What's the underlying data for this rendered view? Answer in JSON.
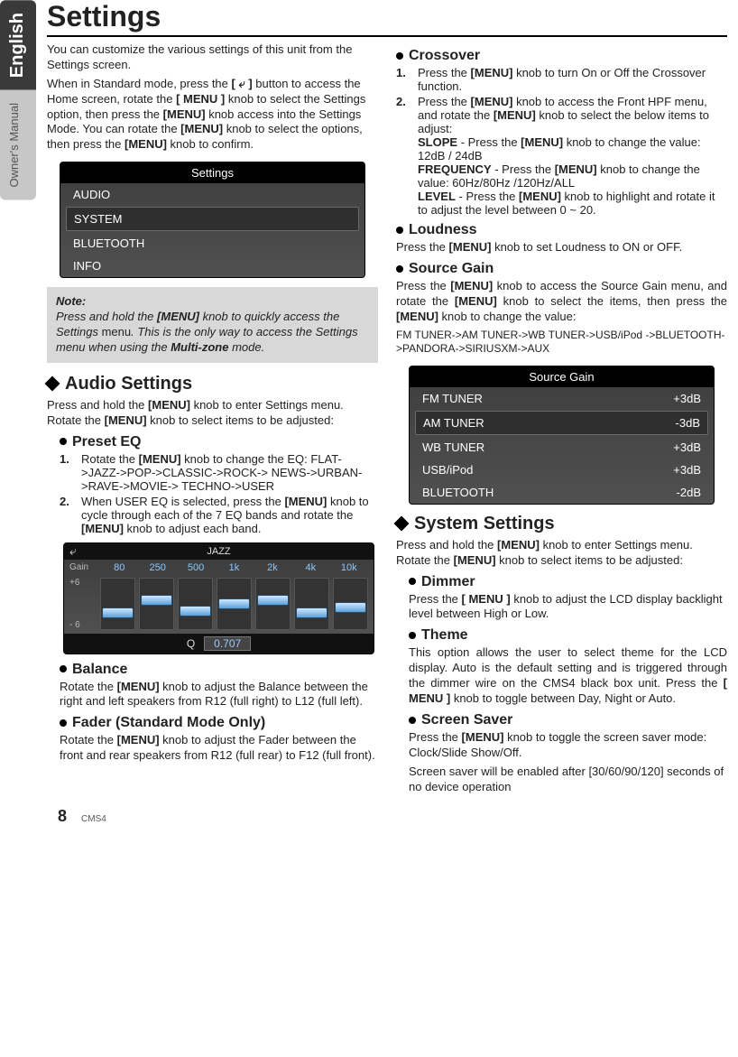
{
  "sideTabs": {
    "dark": "English",
    "light": "Owner's Manual"
  },
  "title": "Settings",
  "intro": {
    "p1a": "You can customize the various settings of this unit from the Settings screen.",
    "p2a": "When in Standard mode, press the ",
    "p2b": "[  ⤶  ]",
    "p2c": " button to access the Home screen, rotate the ",
    "p2d": "[ MENU ]",
    "p2e": " knob to select the Settings  option, then press the ",
    "p2f": "[MENU]",
    "p2g": " knob access into the Settings Mode. You can rotate the ",
    "p2h": "[MENU]",
    "p2i": " knob to select the options, then press the ",
    "p2j": "[MENU]",
    "p2k": " knob to confirm."
  },
  "settingsPanel": {
    "title": "Settings",
    "items": [
      "AUDIO",
      "SYSTEM",
      "BLUETOOTH",
      "INFO"
    ],
    "selectedIndex": 1
  },
  "note": {
    "label": "Note:",
    "a": "Press and hold the ",
    "b": "[MENU]",
    "c": " knob to quickly access the Settings ",
    "d": "menu",
    "e": ". This is the only way to access the Settings menu when using the ",
    "f": "Multi-zone",
    "g": " mode."
  },
  "audio": {
    "heading": "Audio Settings",
    "intro_a": "Press and hold the ",
    "intro_b": "[MENU]",
    "intro_c": " knob to enter Settings menu. Rotate the ",
    "intro_d": "[MENU]",
    "intro_e": " knob to select items to be adjusted:",
    "preset": {
      "heading": "Preset EQ",
      "s1a": "Rotate the ",
      "s1b": "[MENU]",
      "s1c": " knob to change the EQ: FLAT->JAZZ->POP->CLASSIC->ROCK-> NEWS->URBAN->RAVE->MOVIE-> TECHNO->USER",
      "s2a": "When USER EQ is selected, press the ",
      "s2b": "[MENU]",
      "s2c": " knob to cycle through each of the 7 EQ bands and rotate the ",
      "s2d": "[MENU]",
      "s2e": " knob to adjust each band."
    },
    "eq": {
      "title": "JAZZ",
      "gainLabel": "Gain",
      "freqs": [
        "80",
        "250",
        "500",
        "1k",
        "2k",
        "4k",
        "10k"
      ],
      "scaleTop": "+6",
      "scaleBot": "- 6",
      "thumbPos": [
        32,
        18,
        30,
        22,
        18,
        32,
        26
      ],
      "qLabel": "Q",
      "qValue": "0.707"
    },
    "balance": {
      "heading": "Balance",
      "a": "Rotate the ",
      "b": "[MENU]",
      "c": " knob to adjust the Balance between the right and left speakers from R12 (full right) to L12 (full left)."
    },
    "fader": {
      "heading": "Fader (Standard Mode Only)",
      "a": "Rotate the ",
      "b": "[MENU]",
      "c": " knob to adjust the Fader between the front and rear speakers from R12 (full rear) to F12 (full front)."
    }
  },
  "crossover": {
    "heading": "Crossover",
    "s1a": "Press the ",
    "s1b": "[MENU]",
    "s1c": " knob to turn On or Off the Crossover function.",
    "s2a": "Press the ",
    "s2b": "[MENU]",
    "s2c": " knob to access the Front HPF menu, and rotate the ",
    "s2d": "[MENU]",
    "s2e": " knob to select the below items to adjust:",
    "slope_l": "SLOPE",
    "slope_a": " - Press the ",
    "slope_b": "[MENU]",
    "slope_c": " knob to change the value: 12dB / 24dB",
    "freq_l": "FREQUENCY",
    "freq_a": " - Press the ",
    "freq_b": "[MENU]",
    "freq_c": " knob to change the value: 60Hz/80Hz /120Hz/ALL",
    "level_l": "LEVEL",
    "level_a": " - Press the ",
    "level_b": "[MENU]",
    "level_c": " knob to highlight and rotate it to adjust the level between 0 ~ 20."
  },
  "loudness": {
    "heading": "Loudness",
    "a": "Press the ",
    "b": "[MENU]",
    "c": " knob to set Loudness to ON or OFF."
  },
  "sourceGain": {
    "heading": "Source Gain",
    "a": "Press the ",
    "b": "[MENU]",
    "c": " knob to access the Source Gain menu, and rotate the ",
    "d": "[MENU]",
    "e": " knob to select the items, then press the ",
    "f": "[MENU]",
    "g": " knob to change the value:",
    "chain": "FM TUNER->AM TUNER->WB TUNER->USB/iPod ->BLUETOOTH->PANDORA->SIRIUSXM->AUX",
    "panel": {
      "title": "Source Gain",
      "rows": [
        {
          "name": "FM TUNER",
          "val": "+3dB"
        },
        {
          "name": "AM TUNER",
          "val": "-3dB"
        },
        {
          "name": "WB TUNER",
          "val": "+3dB"
        },
        {
          "name": "USB/iPod",
          "val": "+3dB"
        },
        {
          "name": "BLUETOOTH",
          "val": "-2dB"
        }
      ],
      "selectedIndex": 1
    }
  },
  "system": {
    "heading": "System Settings",
    "intro_a": "Press and hold the ",
    "intro_b": "[MENU]",
    "intro_c": " knob to enter Settings menu. Rotate the ",
    "intro_d": "[MENU]",
    "intro_e": " knob to select items to be adjusted:",
    "dimmer": {
      "heading": "Dimmer",
      "a": "Press the ",
      "b": "[ MENU ]",
      "c": " knob to adjust the LCD display backlight level between High or Low."
    },
    "theme": {
      "heading": "Theme",
      "a": "This option allows the user to select theme for the LCD display. Auto is the default setting and is triggered through the dimmer wire on the CMS4 black box unit. Press the ",
      "b": "[ MENU ]",
      "c": " knob to toggle between Day, Night or Auto."
    },
    "saver": {
      "heading": "Screen Saver",
      "a": "Press the ",
      "b": "[MENU]",
      "c": " knob to toggle the screen saver mode: Clock/Slide Show/Off.",
      "d": "Screen saver will be enabled after [30/60/90/120] seconds of no device operation"
    }
  },
  "footer": {
    "page": "8",
    "model": "CMS4"
  }
}
